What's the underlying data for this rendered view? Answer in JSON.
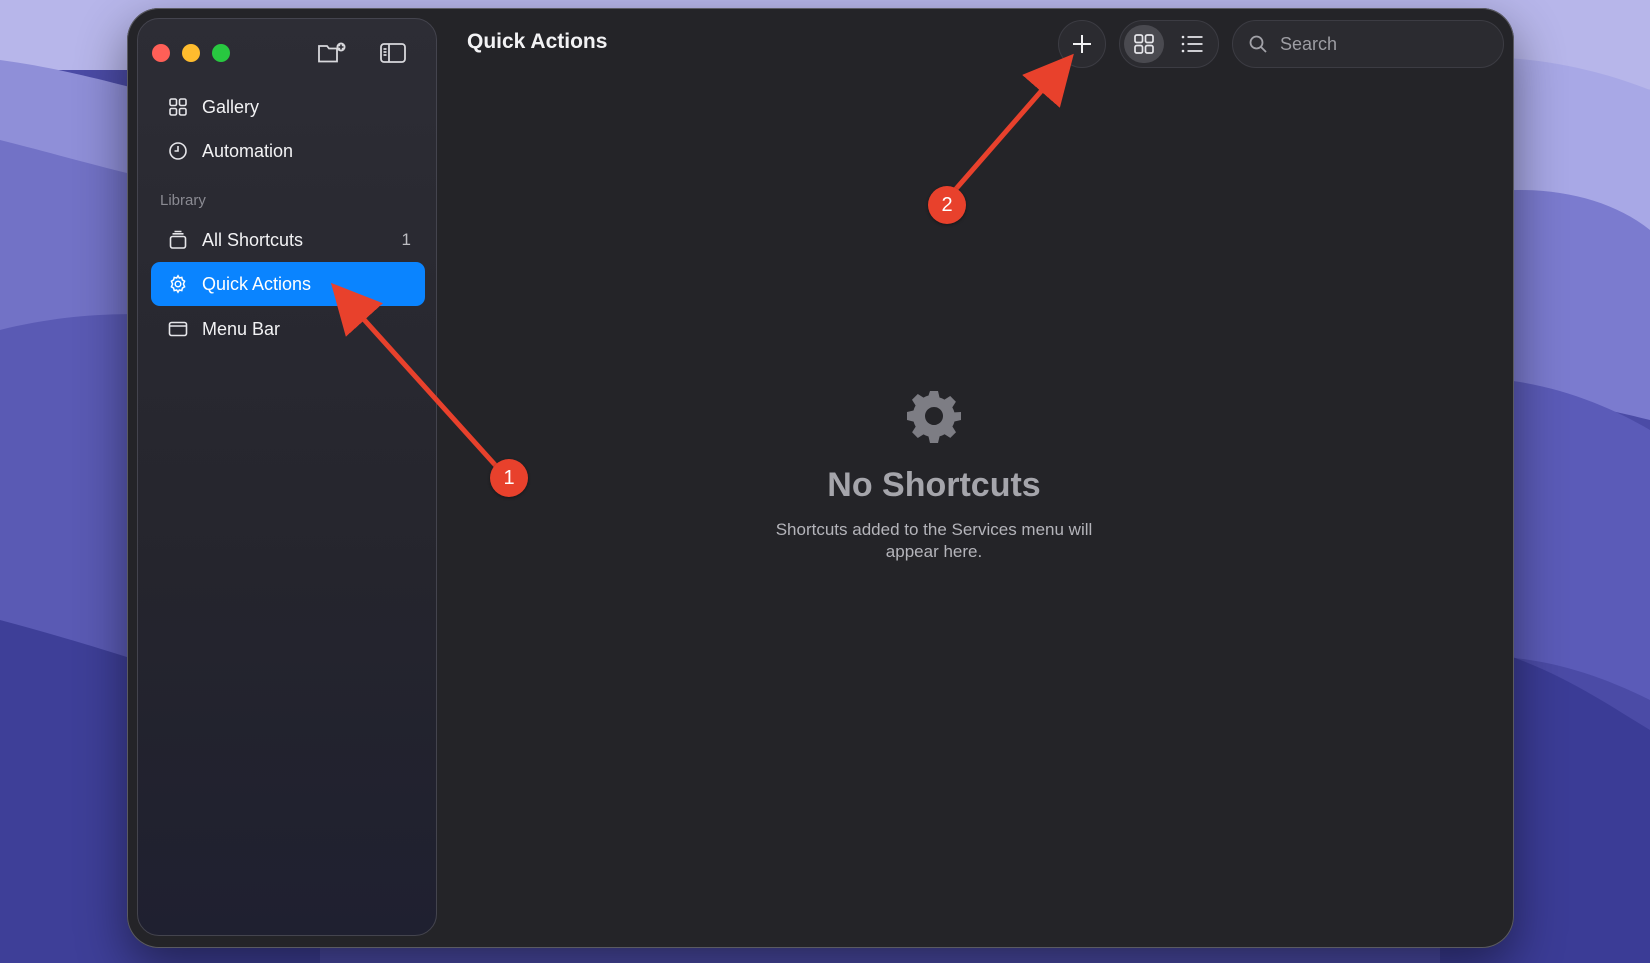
{
  "window": {
    "title": "Quick Actions"
  },
  "sidebar": {
    "items": [
      {
        "label": "Gallery",
        "icon": "grid-icon"
      },
      {
        "label": "Automation",
        "icon": "clock-icon"
      }
    ],
    "section_label": "Library",
    "library": [
      {
        "label": "All Shortcuts",
        "count": "1",
        "icon": "stack-icon"
      },
      {
        "label": "Quick Actions",
        "icon": "gear-icon",
        "selected": true
      },
      {
        "label": "Menu Bar",
        "icon": "menubar-icon"
      }
    ]
  },
  "toolbar": {
    "search_placeholder": "Search",
    "view_mode": "grid"
  },
  "empty_state": {
    "heading": "No Shortcuts",
    "description_line1": "Shortcuts added to the Services menu will",
    "description_line2": "appear here."
  },
  "annotations": [
    {
      "number": "1"
    },
    {
      "number": "2"
    }
  ],
  "colors": {
    "accent": "#0a84ff",
    "annotation": "#e8412c",
    "window_bg": "#242428"
  }
}
